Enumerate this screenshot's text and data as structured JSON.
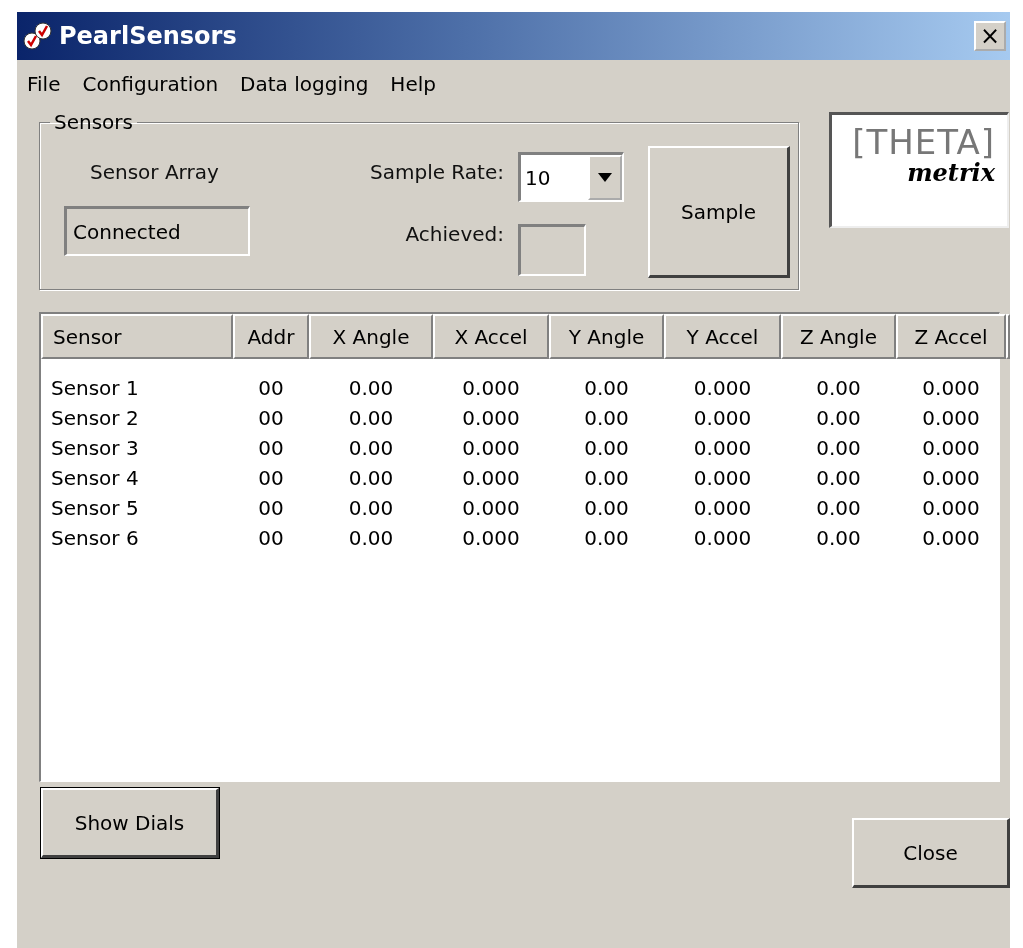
{
  "window": {
    "title": "PearlSensors",
    "close_glyph": "×"
  },
  "menu": [
    {
      "label": "File"
    },
    {
      "label": "Configuration"
    },
    {
      "label": "Data logging"
    },
    {
      "label": "Help"
    }
  ],
  "sensors_group": {
    "title": "Sensors",
    "array_label": "Sensor Array",
    "status": "Connected",
    "sample_rate_label": "Sample Rate:",
    "sample_rate": "10",
    "achieved_label": "Achieved:",
    "sample_button": "Sample"
  },
  "logo": {
    "top": "[THETA]",
    "bottom": "metrix"
  },
  "table": {
    "columns": [
      "Sensor",
      "Addr",
      "X Angle",
      "X Accel",
      "Y Angle",
      "Y Accel",
      "Z Angle",
      "Z Accel"
    ],
    "rows": [
      [
        "Sensor 1",
        "00",
        "0.00",
        "0.000",
        "0.00",
        "0.000",
        "0.00",
        "0.000"
      ],
      [
        "Sensor 2",
        "00",
        "0.00",
        "0.000",
        "0.00",
        "0.000",
        "0.00",
        "0.000"
      ],
      [
        "Sensor 3",
        "00",
        "0.00",
        "0.000",
        "0.00",
        "0.000",
        "0.00",
        "0.000"
      ],
      [
        "Sensor 4",
        "00",
        "0.00",
        "0.000",
        "0.00",
        "0.000",
        "0.00",
        "0.000"
      ],
      [
        "Sensor 5",
        "00",
        "0.00",
        "0.000",
        "0.00",
        "0.000",
        "0.00",
        "0.000"
      ],
      [
        "Sensor 6",
        "00",
        "0.00",
        "0.000",
        "0.00",
        "0.000",
        "0.00",
        "0.000"
      ]
    ]
  },
  "buttons": {
    "show_dials": "Show Dials",
    "close": "Close"
  }
}
